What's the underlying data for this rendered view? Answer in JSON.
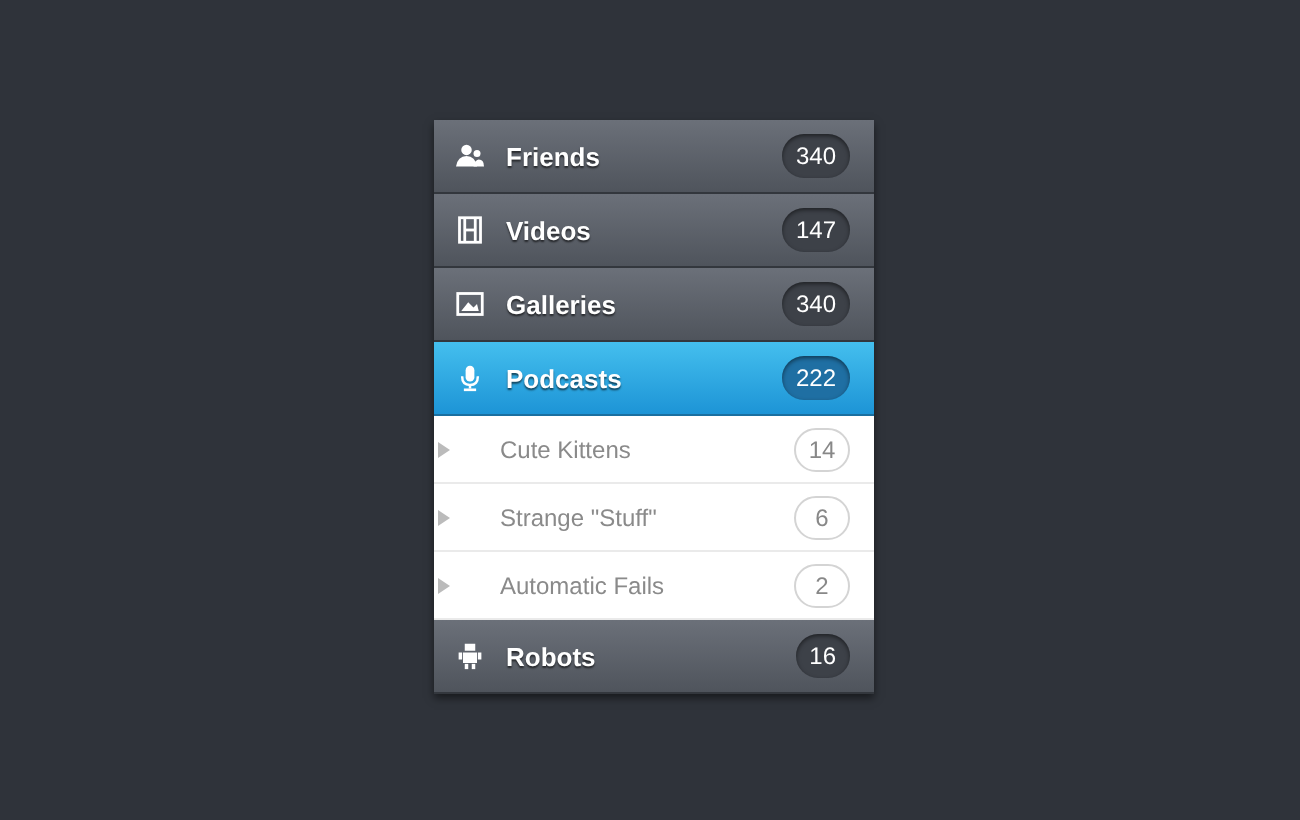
{
  "menu": {
    "items": [
      {
        "label": "Friends",
        "count": "340",
        "selected": false
      },
      {
        "label": "Videos",
        "count": "147",
        "selected": false
      },
      {
        "label": "Galleries",
        "count": "340",
        "selected": false
      },
      {
        "label": "Podcasts",
        "count": "222",
        "selected": true,
        "children": [
          {
            "label": "Cute Kittens",
            "count": "14"
          },
          {
            "label": "Strange \"Stuff\"",
            "count": "6"
          },
          {
            "label": "Automatic Fails",
            "count": "2"
          }
        ]
      },
      {
        "label": "Robots",
        "count": "16",
        "selected": false
      }
    ]
  }
}
